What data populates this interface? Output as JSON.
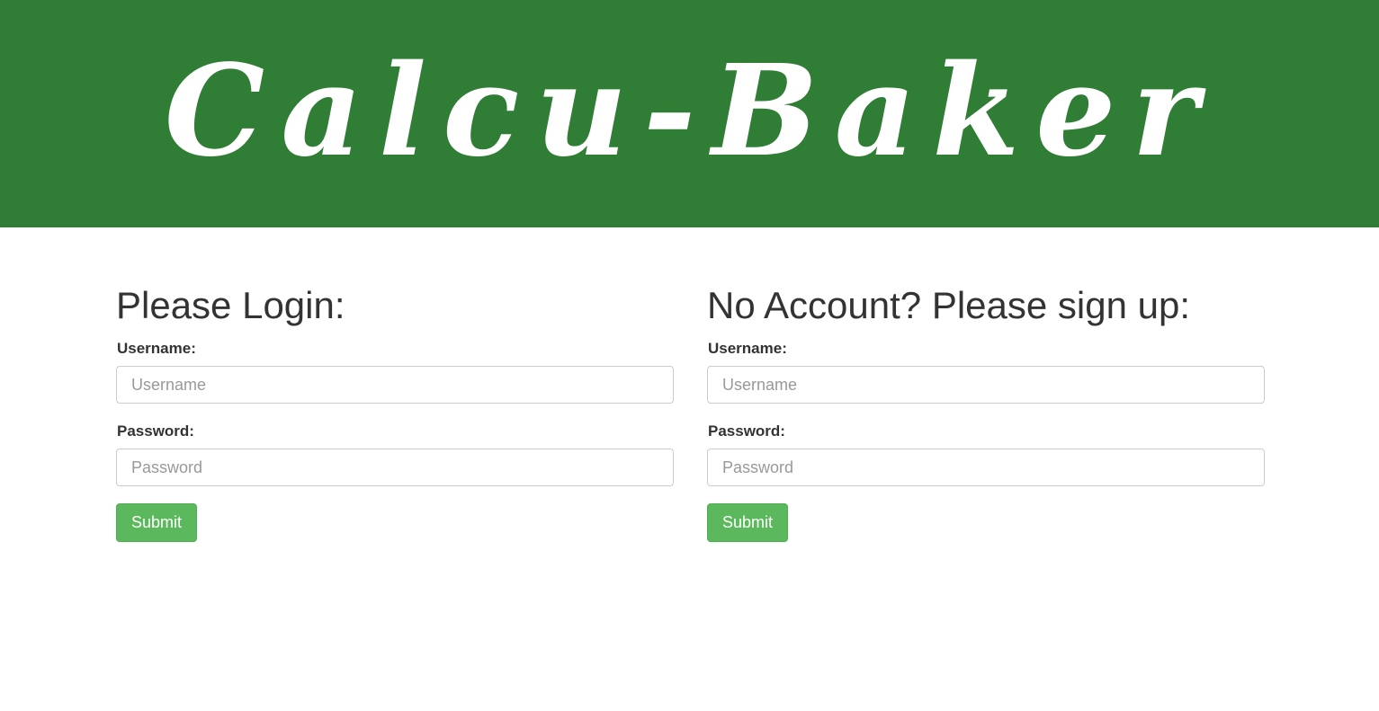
{
  "header": {
    "brand": "Calcu-Baker"
  },
  "login": {
    "title": "Please Login:",
    "username_label": "Username:",
    "username_placeholder": "Username",
    "password_label": "Password:",
    "password_placeholder": "Password",
    "submit_label": "Submit"
  },
  "signup": {
    "title": "No Account? Please sign up:",
    "username_label": "Username:",
    "username_placeholder": "Username",
    "password_label": "Password:",
    "password_placeholder": "Password",
    "submit_label": "Submit"
  },
  "colors": {
    "banner": "#307d35",
    "button": "#5cb85c",
    "button_border": "#4cae4c",
    "text": "#333333"
  }
}
